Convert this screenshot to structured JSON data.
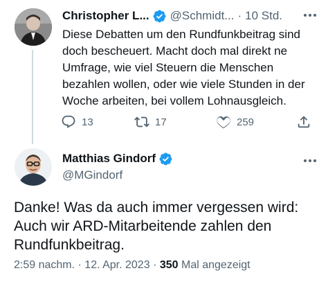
{
  "tweet1": {
    "author_name": "Christopher L...",
    "handle": "@Schmidt...",
    "dot": "·",
    "time": "10 Std.",
    "text": "Diese Debatten um den Rundfunkbeitrag sind doch bescheuert. Macht doch mal direkt ne Umfrage, wie viel Steuern die Menschen bezahlen wollen, oder wie viele Stunden in der Woche arbeiten, bei vollem Lohnausgleich.",
    "replies": "13",
    "retweets": "17",
    "likes": "259"
  },
  "tweet2": {
    "author_name": "Matthias Gindorf",
    "handle": "@MGindorf",
    "text": "Danke! Was da auch immer vergessen wird: Auch wir ARD-Mitarbeitende zahlen den Rundfunkbeitrag.",
    "time": "2:59 nachm.",
    "sep1": "·",
    "date": "12. Apr. 2023",
    "sep2": "·",
    "views": "350",
    "views_label": "Mal angezeigt"
  },
  "colors": {
    "text": "#0f1419",
    "secondary": "#536471",
    "verified": "#1d9bf0",
    "thread_line": "#cfd9de"
  },
  "icons": [
    "verified-badge-icon",
    "more-icon",
    "reply-icon",
    "retweet-icon",
    "like-icon",
    "share-icon"
  ]
}
